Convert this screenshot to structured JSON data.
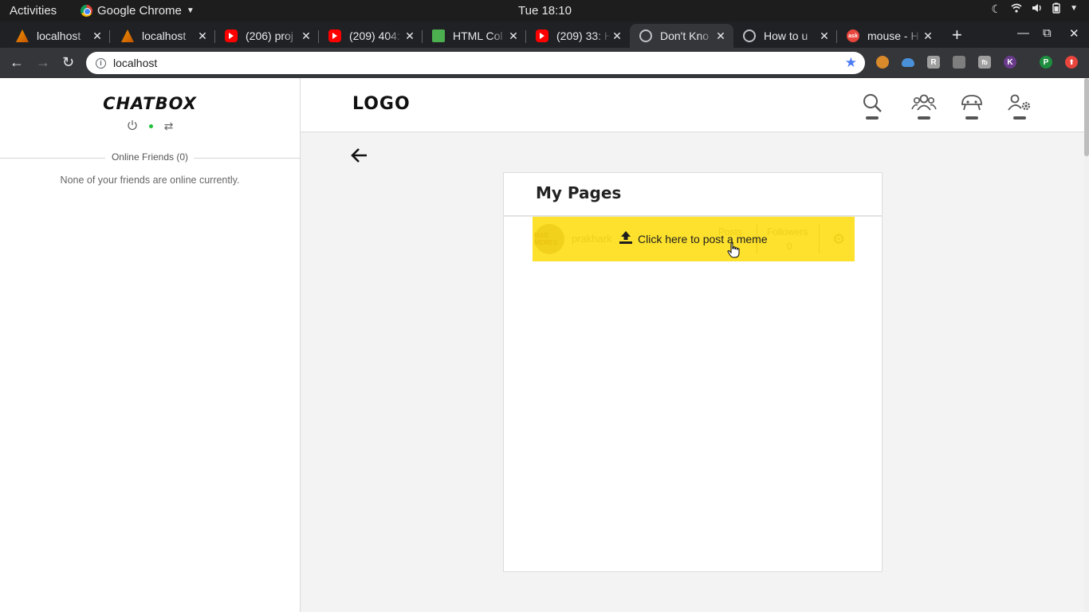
{
  "system": {
    "activities": "Activities",
    "app_name": "Google Chrome",
    "clock": "Tue 18:10"
  },
  "browser": {
    "tabs": [
      {
        "title": "localhost",
        "icon": "lamp-icon"
      },
      {
        "title": "localhost",
        "icon": "lamp-icon"
      },
      {
        "title": "(206) proj",
        "icon": "youtube-icon"
      },
      {
        "title": "(209) 404:",
        "icon": "youtube-icon"
      },
      {
        "title": "HTML Col",
        "icon": "html-color-icon"
      },
      {
        "title": "(209) 33: H",
        "icon": "youtube-icon"
      },
      {
        "title": "Don't Kno",
        "icon": "globe-icon",
        "active": true
      },
      {
        "title": "How to u",
        "icon": "globe-icon"
      },
      {
        "title": "mouse - H",
        "icon": "ask-icon"
      }
    ],
    "url": "localhost",
    "extensions": [
      {
        "label": "",
        "color": "#d98a2b"
      },
      {
        "label": "",
        "color": "#4a90d9"
      },
      {
        "label": "R",
        "color": "#9e9e9e"
      },
      {
        "label": "",
        "color": "#9e9e9e"
      },
      {
        "label": "fb",
        "color": "#9e9e9e"
      },
      {
        "label": "K",
        "color": "#6a3b8c"
      },
      {
        "label": "P",
        "color": "#1e8e3e"
      },
      {
        "label": "",
        "color": "#e8453c"
      }
    ]
  },
  "chatbox": {
    "title": "CHATBOX",
    "online_label": "Online Friends (0)",
    "empty_message": "None of your friends are online currently."
  },
  "header": {
    "logo": "LOGO",
    "icons": [
      "search-icon",
      "friends-icon",
      "memes-icon",
      "settings-icon"
    ]
  },
  "main": {
    "card_title": "My Pages",
    "page_row": {
      "avatar_text": "MAD MEMES",
      "page_name": "prakhark",
      "posts_label": "Posts",
      "followers_label": "Followers",
      "followers_count": "0",
      "post_cta": "Click here to post a meme"
    }
  },
  "colors": {
    "highlight": "#fde12d",
    "online_dot": "#1fbf3a"
  }
}
